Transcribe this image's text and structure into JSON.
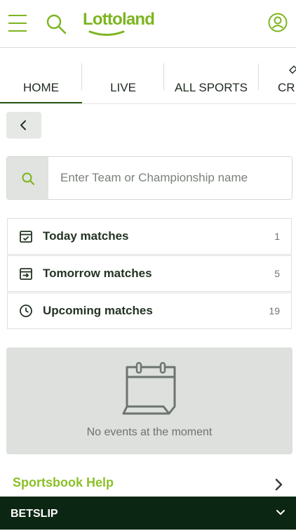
{
  "header": {
    "logo_text": "Lottoland",
    "brand_color": "#7cb51f",
    "icons": [
      "hamburger-menu-icon",
      "search-icon",
      "user-account-icon"
    ]
  },
  "tabs": [
    {
      "label": "HOME",
      "active": true
    },
    {
      "label": "LIVE",
      "active": false
    },
    {
      "label": "ALL SPORTS",
      "active": false
    },
    {
      "label": "CRI",
      "active": false
    }
  ],
  "search": {
    "placeholder": "Enter Team or Championship name",
    "value": ""
  },
  "matches": [
    {
      "label": "Today matches",
      "count": "1",
      "icon": "calendar-check-icon"
    },
    {
      "label": "Tomorrow matches",
      "count": "5",
      "icon": "calendar-arrow-icon"
    },
    {
      "label": "Upcoming matches",
      "count": "19",
      "icon": "clock-icon"
    }
  ],
  "empty_state": {
    "message": "No events at the moment",
    "icon": "calendar-icon"
  },
  "help": {
    "label": "Sportsbook Help",
    "color": "#8cc02a"
  },
  "betslip": {
    "label": "BETSLIP",
    "background": "#0b2612"
  }
}
